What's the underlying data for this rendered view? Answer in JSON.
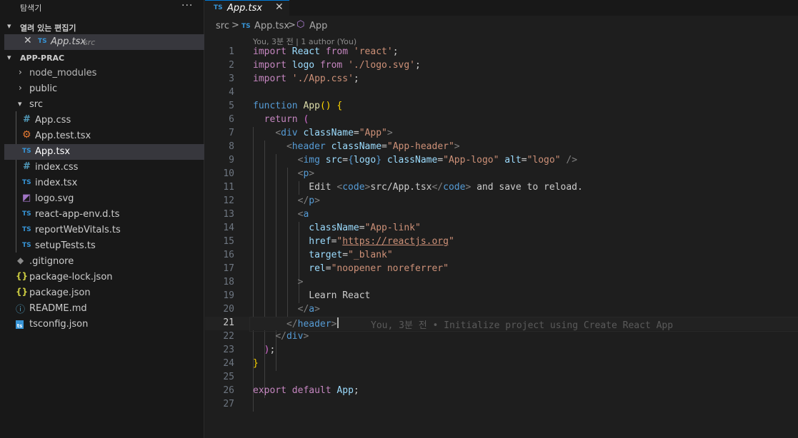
{
  "explorer": {
    "title": "탐색기",
    "more": "···",
    "open_editors_title": "열려 있는 편집기",
    "open_editor": {
      "name": "App.tsx",
      "folder": "src",
      "type_badge": "TS"
    },
    "project_title": "APP-PRAC",
    "items": [
      {
        "label": "node_modules",
        "kind": "folder",
        "icon": "chevron-right-icon"
      },
      {
        "label": "public",
        "kind": "folder",
        "icon": "chevron-right-icon"
      },
      {
        "label": "src",
        "kind": "folder-open",
        "icon": "chevron-down-icon"
      },
      {
        "label": "App.css",
        "badge": "#",
        "icon": "css-file-icon"
      },
      {
        "label": "App.test.tsx",
        "badge": "⚙",
        "icon": "test-file-icon"
      },
      {
        "label": "App.tsx",
        "badge": "TS",
        "icon": "typescript-file-icon",
        "selected": true
      },
      {
        "label": "index.css",
        "badge": "#",
        "icon": "css-file-icon"
      },
      {
        "label": "index.tsx",
        "badge": "TS",
        "icon": "typescript-file-icon"
      },
      {
        "label": "logo.svg",
        "badge": "◩",
        "icon": "svg-file-icon"
      },
      {
        "label": "react-app-env.d.ts",
        "badge": "TS",
        "icon": "typescript-file-icon"
      },
      {
        "label": "reportWebVitals.ts",
        "badge": "TS",
        "icon": "typescript-file-icon"
      },
      {
        "label": "setupTests.ts",
        "badge": "TS",
        "icon": "typescript-file-icon"
      },
      {
        "label": ".gitignore",
        "badge": "◆",
        "icon": "git-file-icon"
      },
      {
        "label": "package-lock.json",
        "badge": "{}",
        "icon": "json-file-icon"
      },
      {
        "label": "package.json",
        "badge": "{}",
        "icon": "json-file-icon"
      },
      {
        "label": "README.md",
        "badge": "ⓘ",
        "icon": "info-file-icon"
      },
      {
        "label": "tsconfig.json",
        "badge": "ts",
        "icon": "tsconfig-file-icon"
      }
    ]
  },
  "editor": {
    "tab": {
      "badge": "TS",
      "name": "App.tsx",
      "close": "✕"
    },
    "breadcrumb": {
      "folder": "src",
      "sep": ">",
      "badge": "TS",
      "file": "App.tsx",
      "symbol": "App"
    },
    "blame_header": "You, 3분 전 | 1 author (You)",
    "inline_blame": "You, 3분 전 • Initialize project using Create React App",
    "current_line": 21,
    "line_numbers": [
      "1",
      "2",
      "3",
      "4",
      "5",
      "6",
      "7",
      "8",
      "9",
      "10",
      "11",
      "12",
      "13",
      "14",
      "15",
      "16",
      "17",
      "18",
      "19",
      "20",
      "21",
      "22",
      "23",
      "24",
      "25",
      "26",
      "27"
    ]
  },
  "colors": {
    "background": "#1e1e1e",
    "sidebar": "#181818",
    "selection": "#37373d",
    "accent": "#0078d4",
    "typescript": "#3794d6"
  }
}
